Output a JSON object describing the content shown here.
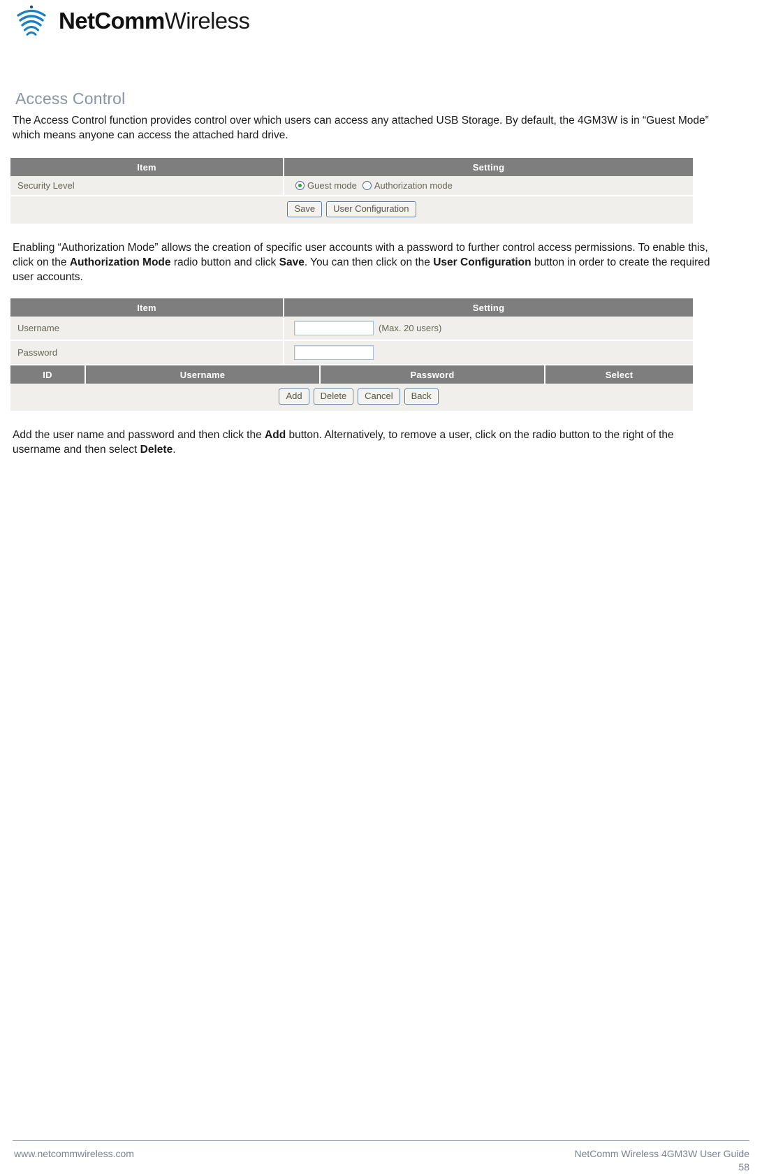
{
  "brand": {
    "logo_icon": "wifi-arcs-icon",
    "name_bold": "NetComm",
    "name_light": "Wireless",
    "logo_color": "#1b7fc4"
  },
  "section": {
    "title": "Access Control",
    "title_color": "#8b93a6"
  },
  "paragraphs": {
    "intro": "The Access Control function provides control over which users can access any attached USB Storage. By default, the 4GM3W is in “Guest Mode” which means anyone can access the attached hard drive.",
    "middle_part1": "Enabling “Authorization Mode” allows the creation of specific user accounts with a password to further control access permissions. To enable this, click on the ",
    "middle_bold1": "Authorization Mode",
    "middle_part2": " radio button and click ",
    "middle_bold2": "Save",
    "middle_part3": ". You can then click on the ",
    "middle_bold3": "User Configuration",
    "middle_part4": " button in order to create the required user accounts.",
    "closing_part1": "Add the user name and password and then click the ",
    "closing_bold1": "Add",
    "closing_part2": " button. Alternatively, to remove a user, click on the radio button to the right of the username and then select ",
    "closing_bold2": "Delete",
    "closing_part3": "."
  },
  "panel_security": {
    "headers": {
      "item": "Item",
      "setting": "Setting"
    },
    "row_label": "Security Level",
    "radios": [
      {
        "label": "Guest mode",
        "checked": true
      },
      {
        "label": "Authorization mode",
        "checked": false
      }
    ],
    "buttons": [
      {
        "label": "Save"
      },
      {
        "label": "User Configuration"
      }
    ]
  },
  "panel_users": {
    "headers": {
      "item": "Item",
      "setting": "Setting"
    },
    "rows": [
      {
        "label": "Username",
        "input_value": "",
        "input_placeholder": "",
        "note": "(Max. 20 users)"
      },
      {
        "label": "Password",
        "input_value": "",
        "input_placeholder": "",
        "note": ""
      }
    ],
    "list_headers": {
      "id": "ID",
      "username": "Username",
      "password": "Password",
      "select": "Select"
    },
    "buttons": [
      {
        "label": "Add"
      },
      {
        "label": "Delete"
      },
      {
        "label": "Cancel"
      },
      {
        "label": "Back"
      }
    ]
  },
  "footer": {
    "website": "www.netcommwireless.com",
    "guide": "NetComm Wireless 4GM3W User Guide",
    "page_number": "58"
  }
}
